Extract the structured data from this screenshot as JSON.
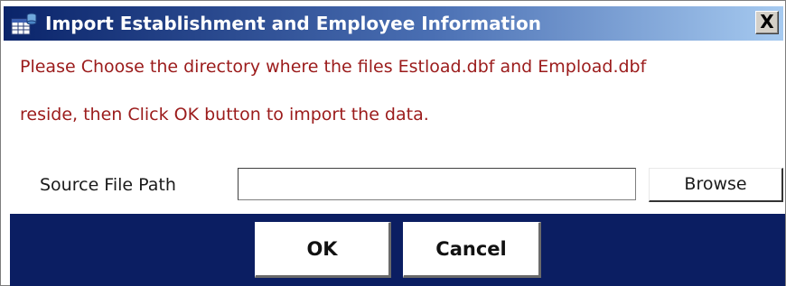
{
  "window": {
    "title": "Import Establishment and Employee Information",
    "icon": "database-table-icon",
    "close_label": "X"
  },
  "message": {
    "line1": "Please Choose the directory where the files Estload.dbf and Empload.dbf",
    "line2": "reside, then Click OK button to import the data."
  },
  "source": {
    "label": "Source File Path",
    "value": "",
    "browse_label": "Browse"
  },
  "actions": {
    "ok_label": "OK",
    "cancel_label": "Cancel"
  },
  "colors": {
    "message_text": "#9b1b1b",
    "footer_background": "#0b1e62",
    "titlebar_start": "#0a246a",
    "titlebar_end": "#a6caf0"
  }
}
